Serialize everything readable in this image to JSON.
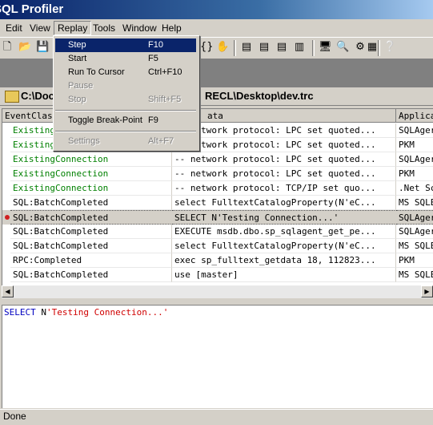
{
  "window": {
    "title": "SQL Profiler"
  },
  "menubar": {
    "items": [
      "Edit",
      "View",
      "Replay",
      "Tools",
      "Window",
      "Help"
    ]
  },
  "replay_menu": {
    "items": [
      {
        "label": "Step",
        "shortcut": "F10",
        "state": "highlighted"
      },
      {
        "label": "Start",
        "shortcut": "F5",
        "state": "enabled"
      },
      {
        "label": "Run To Cursor",
        "shortcut": "Ctrl+F10",
        "state": "enabled"
      },
      {
        "label": "Pause",
        "shortcut": "",
        "state": "disabled"
      },
      {
        "label": "Stop",
        "shortcut": "Shift+F5",
        "state": "disabled"
      },
      {
        "label": "Toggle Break-Point",
        "shortcut": "F9",
        "state": "enabled"
      },
      {
        "label": "Settings",
        "shortcut": "Alt+F7",
        "state": "disabled"
      }
    ]
  },
  "document": {
    "title_left": "C:\\Docu",
    "title_right": "RECL\\Desktop\\dev.trc"
  },
  "trace_grid": {
    "columns": [
      "EventClass",
      "ata",
      "Applica"
    ],
    "rows": [
      {
        "event": "Existing",
        "data": "-- network protocol: LPC set quoted...",
        "app": "SQLAger",
        "green": true,
        "selected": false,
        "breakpoint": false
      },
      {
        "event": "Existing",
        "data": "-- network protocol: LPC set quoted...",
        "app": "PKM",
        "green": true,
        "selected": false,
        "breakpoint": false
      },
      {
        "event": "ExistingConnection",
        "data": "-- network protocol: LPC set quoted...",
        "app": "SQLAger",
        "green": true,
        "selected": false,
        "breakpoint": false
      },
      {
        "event": "ExistingConnection",
        "data": "-- network protocol: LPC set quoted...",
        "app": "PKM",
        "green": true,
        "selected": false,
        "breakpoint": false
      },
      {
        "event": "ExistingConnection",
        "data": "-- network protocol: TCP/IP set quo...",
        "app": ".Net Sc",
        "green": true,
        "selected": false,
        "breakpoint": false
      },
      {
        "event": "SQL:BatchCompleted",
        "data": "select FulltextCatalogProperty(N'eC...",
        "app": "MS SQLE",
        "green": false,
        "selected": false,
        "breakpoint": false
      },
      {
        "event": "SQL:BatchCompleted",
        "data": "SELECT N'Testing Connection...'",
        "app": "SQLAger",
        "green": false,
        "selected": true,
        "breakpoint": true
      },
      {
        "event": "SQL:BatchCompleted",
        "data": "EXECUTE msdb.dbo.sp_sqlagent_get_pe...",
        "app": "SQLAger",
        "green": false,
        "selected": false,
        "breakpoint": false
      },
      {
        "event": "SQL:BatchCompleted",
        "data": "select FulltextCatalogProperty(N'eC...",
        "app": "MS SQLE",
        "green": false,
        "selected": false,
        "breakpoint": false
      },
      {
        "event": "RPC:Completed",
        "data": "exec sp_fulltext_getdata 18, 112823...",
        "app": "PKM",
        "green": false,
        "selected": false,
        "breakpoint": false
      },
      {
        "event": "SQL:BatchCompleted",
        "data": "use [master]",
        "app": "MS SQLE",
        "green": false,
        "selected": false,
        "breakpoint": false
      }
    ]
  },
  "editor": {
    "keyword": "SELECT",
    "middle": " N",
    "string": "'Testing Connection...'"
  },
  "statusbar": {
    "text": "Done"
  },
  "toolbar": {
    "icons": [
      "new-trace-icon",
      "open-icon",
      "save-icon",
      "properties-icon",
      "find-icon",
      "scroll-icon",
      "pan-icon",
      "align-left-icon",
      "align-center-icon",
      "align-right-icon",
      "copy-icon",
      "run-icon",
      "debug-icon",
      "settings-icon",
      "help-icon"
    ]
  }
}
